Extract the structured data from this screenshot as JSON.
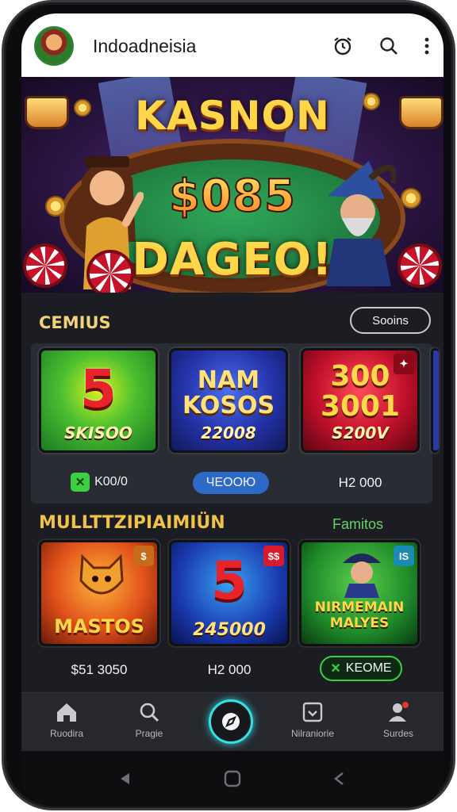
{
  "app": {
    "title": "Indoadneisia"
  },
  "banner": {
    "title": "KASNON",
    "amount": "$085",
    "subtitle": "DAGEO!"
  },
  "section1": {
    "title": "CEMIUS",
    "button": "Sooins",
    "cards": [
      {
        "big": "5",
        "sub": "SKISOO",
        "price": "K00/0"
      },
      {
        "big": "NAM KOSOS",
        "sub": "22008",
        "price": "ЧЕООЮ"
      },
      {
        "big": "300 3001",
        "sub": "S200V",
        "price": "H2 000"
      }
    ]
  },
  "section2": {
    "title": "MULLTTZIPIAIMIÜN",
    "link": "Famitos",
    "cards": [
      {
        "big": "MASTOS",
        "sub": "",
        "price": "$51 3050",
        "corner": "$"
      },
      {
        "big": "5",
        "sub": "245000",
        "price": "H2 000",
        "corner": "$$"
      },
      {
        "big": "NIRMEMAIN MALYES",
        "sub": "",
        "price": "KEOME",
        "corner": "IS"
      }
    ]
  },
  "nav": {
    "items": [
      "Ruodira",
      "Pragie",
      "",
      "Nilraniorie",
      "Surdes"
    ]
  },
  "colors": {
    "accent": "#34e0e4",
    "gold": "#f2d27a",
    "green": "#63d36a",
    "bg": "#1b1d22"
  },
  "icons": [
    "alarm-clock-icon",
    "search-icon",
    "more-vertical-icon",
    "home-icon",
    "search-icon",
    "compass-icon",
    "inbox-icon",
    "user-icon"
  ]
}
